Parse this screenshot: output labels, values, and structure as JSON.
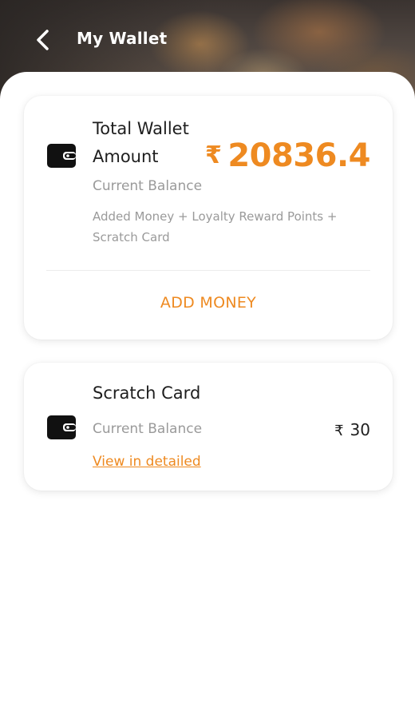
{
  "header": {
    "title": "My Wallet",
    "back_icon": "chevron-left-icon"
  },
  "wallet_card": {
    "title": "Total Wallet Amount",
    "currency": "₹",
    "amount": "20836.4",
    "subtitle": "Current Balance",
    "description": "Added Money + Loyalty Reward Points + Scratch Card",
    "action_label": "ADD MONEY",
    "icon": "wallet-icon"
  },
  "scratch_card": {
    "title": "Scratch Card",
    "subtitle": "Current Balance",
    "currency": "₹",
    "amount": "30",
    "link_label": "View in detailed",
    "icon": "wallet-icon"
  },
  "colors": {
    "accent": "#ee8a21",
    "text": "#1e1e1e",
    "muted": "#9a9a9a"
  }
}
